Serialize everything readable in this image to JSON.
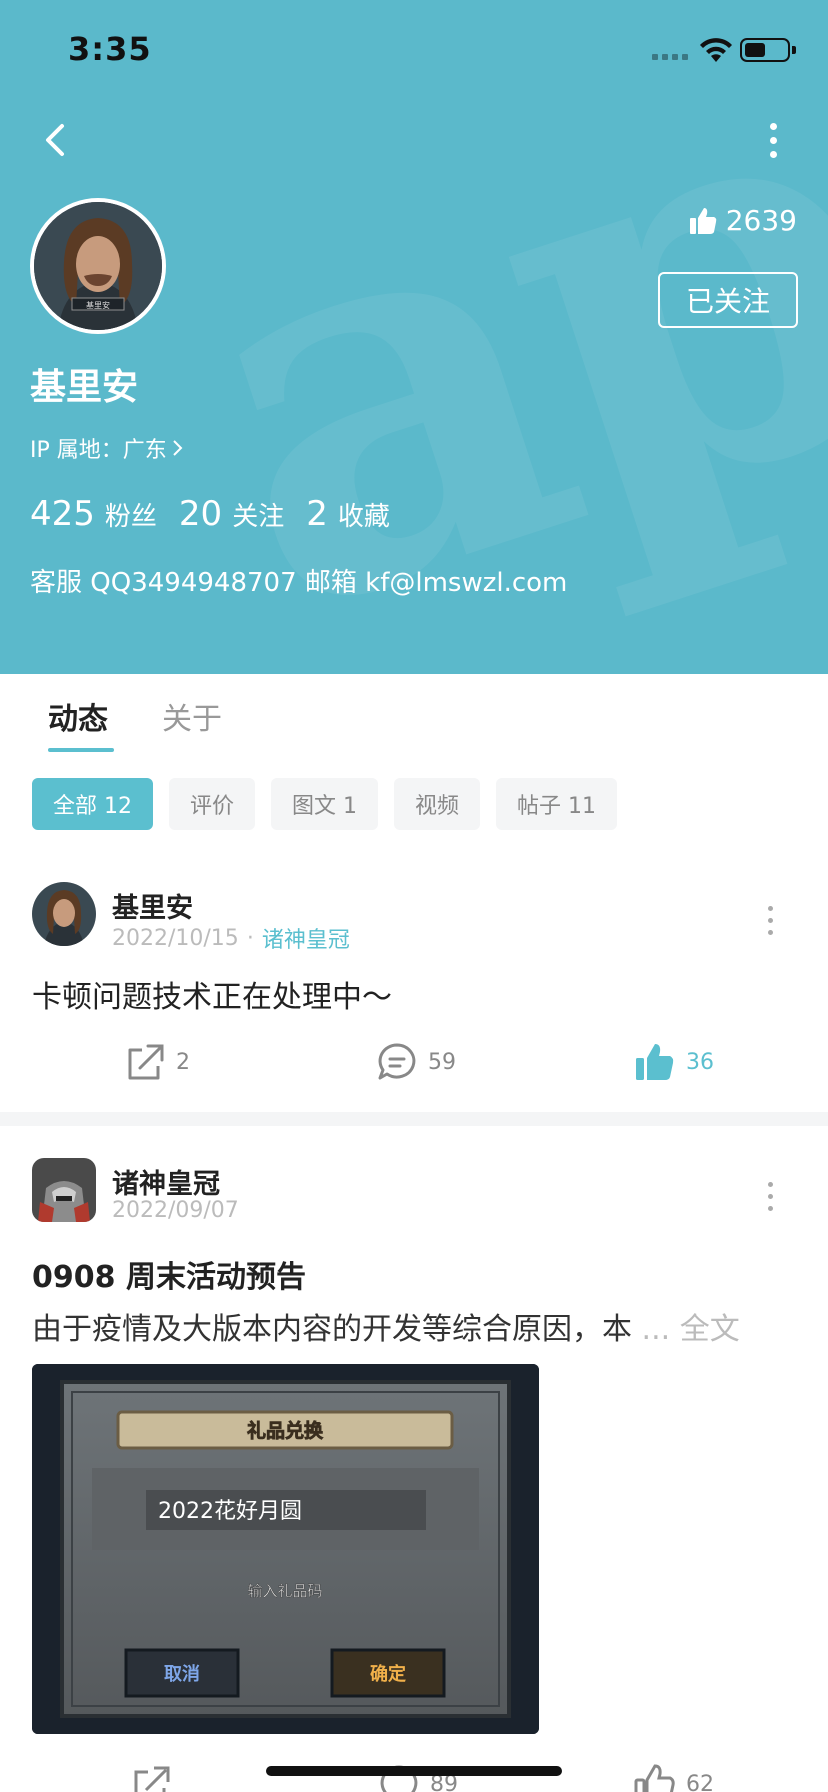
{
  "status_bar": {
    "time": "3:35"
  },
  "profile": {
    "name": "基里安",
    "avatar_caption": "基里安",
    "likes": "2639",
    "follow_label": "已关注",
    "ip_location": "IP 属地：广东",
    "stats": [
      {
        "value": "425",
        "label": "粉丝"
      },
      {
        "value": "20",
        "label": "关注"
      },
      {
        "value": "2",
        "label": "收藏"
      }
    ],
    "contact": "客服 QQ3494948707 邮箱 kf@lmswzl.com"
  },
  "tabs": [
    {
      "label": "动态",
      "active": true
    },
    {
      "label": "关于",
      "active": false
    }
  ],
  "filters": [
    {
      "label": "全部 12",
      "active": true
    },
    {
      "label": "评价",
      "active": false
    },
    {
      "label": "图文 1",
      "active": false
    },
    {
      "label": "视频",
      "active": false
    },
    {
      "label": "帖子 11",
      "active": false
    }
  ],
  "posts": [
    {
      "author": "基里安",
      "date": "2022/10/15",
      "separator": "·",
      "game": "诸神皇冠",
      "text": "卡顿问题技术正在处理中～",
      "shares": "2",
      "comments": "59",
      "likes": "36"
    },
    {
      "author": "诸神皇冠",
      "date": "2022/09/07",
      "title": "0908 周末活动预告",
      "excerpt": "由于疫情及大版本内容的开发等综合原因，本",
      "more_label": "... 全文",
      "image": {
        "banner": "礼品兑换",
        "code": "2022花好月圆",
        "hint": "输入礼品码",
        "cancel": "取消",
        "confirm": "确定"
      },
      "comments": "89",
      "likes": "62"
    }
  ],
  "colors": {
    "header_bg": "#5bb9cb",
    "accent": "#5bbfcf"
  }
}
